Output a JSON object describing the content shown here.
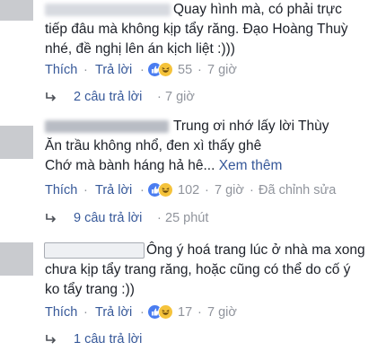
{
  "comments": [
    {
      "lines": [
        "Quay hình mà, có phải trực",
        "tiếp đâu mà không kịp tẩy răng. Đạo Hoàng Thuỳ",
        "nhé, đề nghị lên án kịch liệt :)))"
      ],
      "like_label": "Thích",
      "sep": "·",
      "reply_label": "Trả lời",
      "reaction_count": "55",
      "time": "7 giờ",
      "replies": {
        "text": "2 câu trả lời",
        "time": "7 giờ"
      }
    },
    {
      "lines": [
        "Trung ơi nhớ lấy lời Thùy",
        "Ăn trầu không nhổ, đen xì thấy ghê",
        "Chớ mà bành háng hả hê..."
      ],
      "see_more": "Xem thêm",
      "like_label": "Thích",
      "sep": "·",
      "reply_label": "Trả lời",
      "reaction_count": "102",
      "time": "7 giờ",
      "edited": "Đã chỉnh sửa",
      "replies": {
        "text": "9 câu trả lời",
        "time": "25 phút"
      }
    },
    {
      "lines": [
        "Ông ý hoá trang lúc ở nhà ma xong",
        "chưa kịp tẩy trang răng, hoặc cũng có thể do cố ý",
        "ko tẩy trang :))"
      ],
      "like_label": "Thích",
      "sep": "·",
      "reply_label": "Trả lời",
      "reaction_count": "17",
      "time": "7 giờ",
      "replies": {
        "text": "1 câu trả lời",
        "time": ""
      }
    }
  ],
  "colors": {
    "link": "#365899",
    "meta": "#90949c",
    "text": "#1d2129",
    "like": "#4a7df0",
    "haha": "#f5c33b"
  },
  "icons": {
    "reply_arrow": "reply-arrow-icon",
    "like": "like-reaction-icon",
    "haha": "haha-reaction-icon"
  }
}
